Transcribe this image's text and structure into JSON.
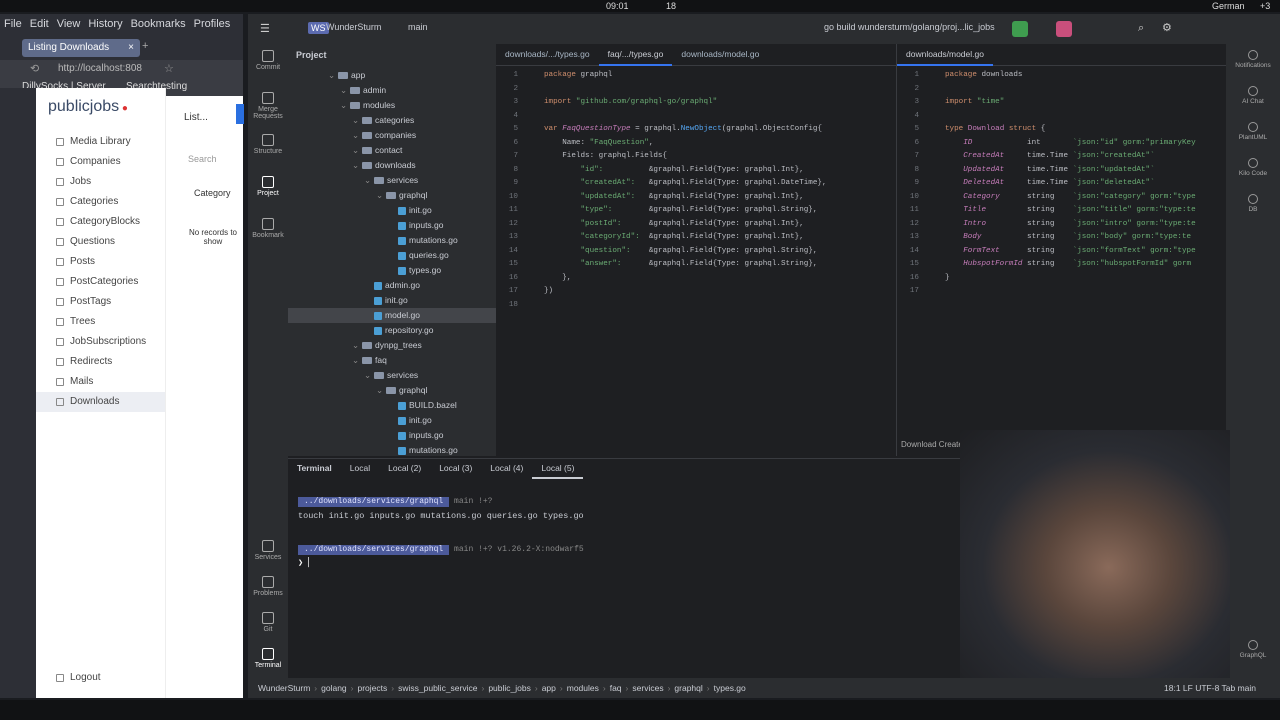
{
  "os": {
    "time": "09:01",
    "date": "18",
    "lang": "German",
    "vol": "+3"
  },
  "browser": {
    "menu": [
      "File",
      "Edit",
      "View",
      "History",
      "Bookmarks",
      "Profiles"
    ],
    "tab": "Listing Downloads",
    "url": "http://localhost:808",
    "bookmarks": [
      "DillySocks | Server",
      "Searchtesting"
    ],
    "brand": "publicjobs",
    "list_title": "List...",
    "search_placeholder": "Search",
    "category_label": "Category",
    "no_records": "No records to show",
    "sidebar": [
      "Media Library",
      "Companies",
      "Jobs",
      "Categories",
      "CategoryBlocks",
      "Questions",
      "Posts",
      "PostCategories",
      "PostTags",
      "Trees",
      "JobSubscriptions",
      "Redirects",
      "Mails",
      "Downloads"
    ],
    "logout": "Logout"
  },
  "ide": {
    "project_name": "WunderSturm",
    "branch": "main",
    "run_config": "go build wundersturm/golang/proj...lic_jobs",
    "project_label": "Project",
    "left_tools": [
      "Commit",
      "Merge Requests",
      "Structure",
      "Project",
      "Bookmark"
    ],
    "left_tools_bottom": [
      "Services",
      "Problems",
      "Git",
      "Terminal"
    ],
    "right_tools": [
      "Notifications",
      "AI Chat",
      "PlantUML",
      "Kilo Code",
      "DB",
      "GraphQL"
    ],
    "tree": [
      {
        "d": 4,
        "t": "folder",
        "n": "app"
      },
      {
        "d": 5,
        "t": "folder",
        "n": "admin"
      },
      {
        "d": 5,
        "t": "folder",
        "n": "modules"
      },
      {
        "d": 6,
        "t": "folder",
        "n": "categories"
      },
      {
        "d": 6,
        "t": "folder",
        "n": "companies"
      },
      {
        "d": 6,
        "t": "folder",
        "n": "contact"
      },
      {
        "d": 6,
        "t": "folder",
        "n": "downloads"
      },
      {
        "d": 7,
        "t": "folder",
        "n": "services"
      },
      {
        "d": 8,
        "t": "folder",
        "n": "graphql"
      },
      {
        "d": 9,
        "t": "go",
        "n": "init.go"
      },
      {
        "d": 9,
        "t": "go",
        "n": "inputs.go"
      },
      {
        "d": 9,
        "t": "go",
        "n": "mutations.go"
      },
      {
        "d": 9,
        "t": "go",
        "n": "queries.go"
      },
      {
        "d": 9,
        "t": "go",
        "n": "types.go"
      },
      {
        "d": 7,
        "t": "go",
        "n": "admin.go"
      },
      {
        "d": 7,
        "t": "go",
        "n": "init.go"
      },
      {
        "d": 7,
        "t": "go",
        "n": "model.go",
        "sel": true
      },
      {
        "d": 7,
        "t": "go",
        "n": "repository.go"
      },
      {
        "d": 6,
        "t": "folder",
        "n": "dynpg_trees"
      },
      {
        "d": 6,
        "t": "folder",
        "n": "faq"
      },
      {
        "d": 7,
        "t": "folder",
        "n": "services"
      },
      {
        "d": 8,
        "t": "folder",
        "n": "graphql"
      },
      {
        "d": 9,
        "t": "go",
        "n": "BUILD.bazel"
      },
      {
        "d": 9,
        "t": "go",
        "n": "init.go"
      },
      {
        "d": 9,
        "t": "go",
        "n": "inputs.go"
      },
      {
        "d": 9,
        "t": "go",
        "n": "mutations.go"
      }
    ],
    "tabs1": [
      "downloads/.../types.go",
      "faq/.../types.go",
      "downloads/model.go"
    ],
    "tabs2": [
      "downloads/model.go"
    ],
    "code1": [
      [
        [
          "kw",
          "package "
        ],
        [
          "id",
          "graphql"
        ]
      ],
      [],
      [
        [
          "kw",
          "import "
        ],
        [
          "str",
          "\"github.com/graphql-go/graphql\""
        ]
      ],
      [],
      [
        [
          "kw",
          "var "
        ],
        [
          "fld",
          "FaqQuestionType"
        ],
        [
          "id",
          " = graphql."
        ],
        [
          "fn",
          "NewObject"
        ],
        [
          "id",
          "(graphql.ObjectConfig{"
        ]
      ],
      [
        [
          "id",
          "    Name: "
        ],
        [
          "str",
          "\"FaqQuestion\""
        ],
        [
          "id",
          ","
        ]
      ],
      [
        [
          "id",
          "    Fields: graphql.Fields{"
        ]
      ],
      [
        [
          "str",
          "        \"id\":"
        ],
        [
          "id",
          "          &graphql.Field{Type: graphql.Int},"
        ]
      ],
      [
        [
          "str",
          "        \"createdAt\":"
        ],
        [
          "id",
          "   &graphql.Field{Type: graphql.DateTime},"
        ]
      ],
      [
        [
          "str",
          "        \"updatedAt\":"
        ],
        [
          "id",
          "   &graphql.Field{Type: graphql.Int},"
        ]
      ],
      [
        [
          "str",
          "        \"type\":"
        ],
        [
          "id",
          "        &graphql.Field{Type: graphql.String},"
        ]
      ],
      [
        [
          "str",
          "        \"postId\":"
        ],
        [
          "id",
          "      &graphql.Field{Type: graphql.Int},"
        ]
      ],
      [
        [
          "str",
          "        \"categoryId\":"
        ],
        [
          "id",
          "  &graphql.Field{Type: graphql.Int},"
        ]
      ],
      [
        [
          "str",
          "        \"question\":"
        ],
        [
          "id",
          "    &graphql.Field{Type: graphql.String},"
        ]
      ],
      [
        [
          "str",
          "        \"answer\":"
        ],
        [
          "id",
          "      &graphql.Field{Type: graphql.String},"
        ]
      ],
      [
        [
          "id",
          "    },"
        ]
      ],
      [
        [
          "id",
          "})"
        ]
      ],
      []
    ],
    "code2": [
      [
        [
          "kw",
          "package "
        ],
        [
          "id",
          "downloads"
        ]
      ],
      [],
      [
        [
          "kw",
          "import "
        ],
        [
          "str",
          "\"time\""
        ]
      ],
      [],
      [
        [
          "kw",
          "type "
        ],
        [
          "typ",
          "Download"
        ],
        [
          "kw",
          " struct "
        ],
        [
          "id",
          "{"
        ]
      ],
      [
        [
          "fld",
          "    ID"
        ],
        [
          "id",
          "            int       "
        ],
        [
          "str",
          "`json:\"id\" gorm:\"primaryKey"
        ]
      ],
      [
        [
          "fld",
          "    CreatedAt"
        ],
        [
          "id",
          "     time.Time "
        ],
        [
          "str",
          "`json:\"createdAt\"`"
        ]
      ],
      [
        [
          "fld",
          "    UpdatedAt"
        ],
        [
          "id",
          "     time.Time "
        ],
        [
          "str",
          "`json:\"updatedAt\"`"
        ]
      ],
      [
        [
          "fld",
          "    DeletedAt"
        ],
        [
          "id",
          "     time.Time "
        ],
        [
          "str",
          "`json:\"deletedAt\"`"
        ]
      ],
      [
        [
          "fld",
          "    Category"
        ],
        [
          "id",
          "      string    "
        ],
        [
          "str",
          "`json:\"category\" gorm:\"type"
        ]
      ],
      [
        [
          "fld",
          "    Title"
        ],
        [
          "id",
          "         string    "
        ],
        [
          "str",
          "`json:\"title\" gorm:\"type:te"
        ]
      ],
      [
        [
          "fld",
          "    Intro"
        ],
        [
          "id",
          "         string    "
        ],
        [
          "str",
          "`json:\"intro\" gorm:\"type:te"
        ]
      ],
      [
        [
          "fld",
          "    Body"
        ],
        [
          "id",
          "          string    "
        ],
        [
          "str",
          "`json:\"body\" gorm:\"type:te"
        ]
      ],
      [
        [
          "fld",
          "    FormText"
        ],
        [
          "id",
          "      string    "
        ],
        [
          "str",
          "`json:\"formText\" gorm:\"type"
        ]
      ],
      [
        [
          "fld",
          "    HubspotFormId"
        ],
        [
          "id",
          " string    "
        ],
        [
          "str",
          "`json:\"hubspotFormId\" gorm"
        ]
      ],
      [
        [
          "id",
          "}"
        ]
      ],
      []
    ],
    "breadcrumb2": "Download    CreatedAt: time.Time",
    "terminal": {
      "label": "Terminal",
      "tabs": [
        "Local",
        "Local (2)",
        "Local (3)",
        "Local (4)",
        "Local (5)"
      ],
      "path": "../downloads/services/graphql",
      "branch": "main !+?",
      "cmd": "touch init.go inputs.go mutations.go queries.go types.go",
      "go_version": "v1.26.2-X:nodwarf5"
    },
    "status_path": [
      "WunderSturm",
      "golang",
      "projects",
      "swiss_public_service",
      "public_jobs",
      "app",
      "modules",
      "faq",
      "services",
      "graphql",
      "types.go"
    ],
    "status_right": "18:1   LF   UTF-8   Tab   main"
  }
}
